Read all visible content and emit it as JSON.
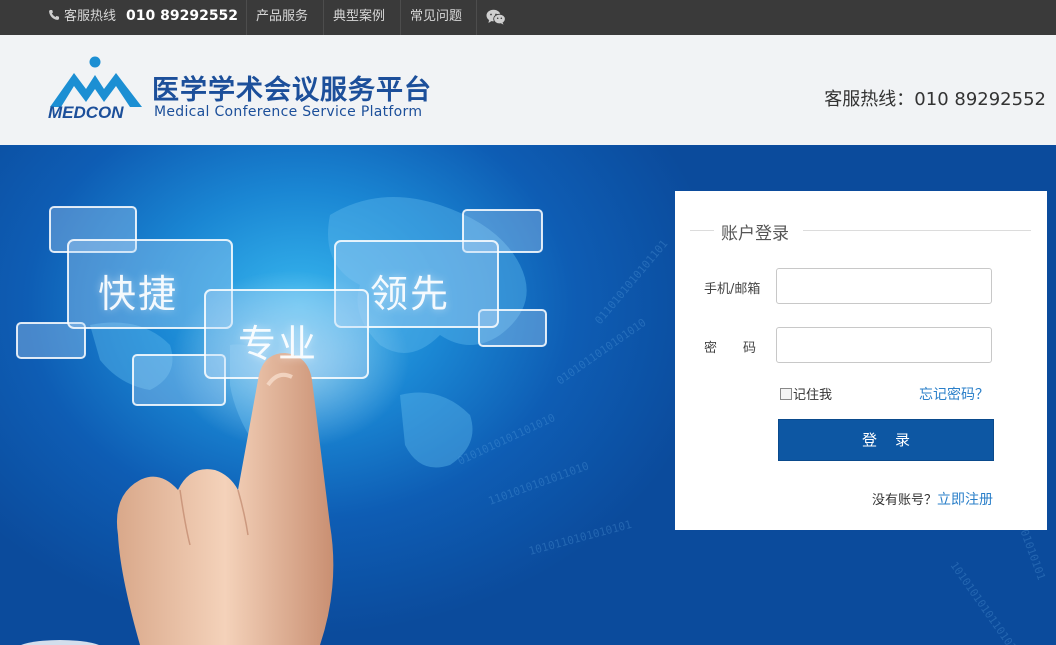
{
  "topbar": {
    "hotline_label": "客服热线",
    "hotline_number": "010 89292552",
    "nav": [
      "产品服务",
      "典型案例",
      "常见问题"
    ],
    "wechat_icon": "wechat-icon",
    "bg_color": "#3a3a3a"
  },
  "header": {
    "logo_text": "MEDCON",
    "title_cn": "医学学术会议服务平台",
    "title_en": "Medical Conference Service Platform",
    "hotline": "客服热线：010 89292552",
    "brand_color": "#1c4f9a"
  },
  "banner": {
    "words": [
      "快捷",
      "领先",
      "专业"
    ]
  },
  "login": {
    "title": "账户登录",
    "account_label": "手机/邮箱",
    "account_value": "",
    "password_label": "密　　码",
    "password_value": "",
    "remember_label": "记住我",
    "forgot_link": "忘记密码？",
    "submit_label": "登录",
    "no_account_text": "没有账号？",
    "register_link": "立即注册",
    "button_color": "#0d57a3",
    "link_color": "#2a7fc9"
  }
}
